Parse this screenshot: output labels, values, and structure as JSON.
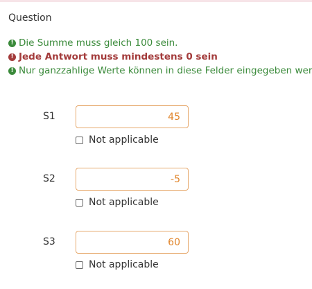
{
  "question": {
    "title": "Question"
  },
  "validation_tips": [
    {
      "icon": "exclamation-circle-icon",
      "status": "ok",
      "text": "Die Summe muss gleich 100 sein."
    },
    {
      "icon": "exclamation-circle-icon",
      "status": "error",
      "text": "Jede Antwort muss mindestens 0 sein"
    },
    {
      "icon": "exclamation-circle-icon",
      "status": "ok",
      "text": "Nur ganzzahlige Werte können in diese Felder eingegeben werd"
    }
  ],
  "rows": [
    {
      "label": "S1",
      "value": "45",
      "checkbox_label": "Not applicable",
      "checked": false
    },
    {
      "label": "S2",
      "value": "-5",
      "checkbox_label": "Not applicable",
      "checked": false
    },
    {
      "label": "S3",
      "value": "60",
      "checkbox_label": "Not applicable",
      "checked": false
    }
  ],
  "colors": {
    "ok": "#3a8a3a",
    "error": "#a33b3b",
    "input_border": "#e6a86c",
    "input_text": "#e1852b"
  }
}
